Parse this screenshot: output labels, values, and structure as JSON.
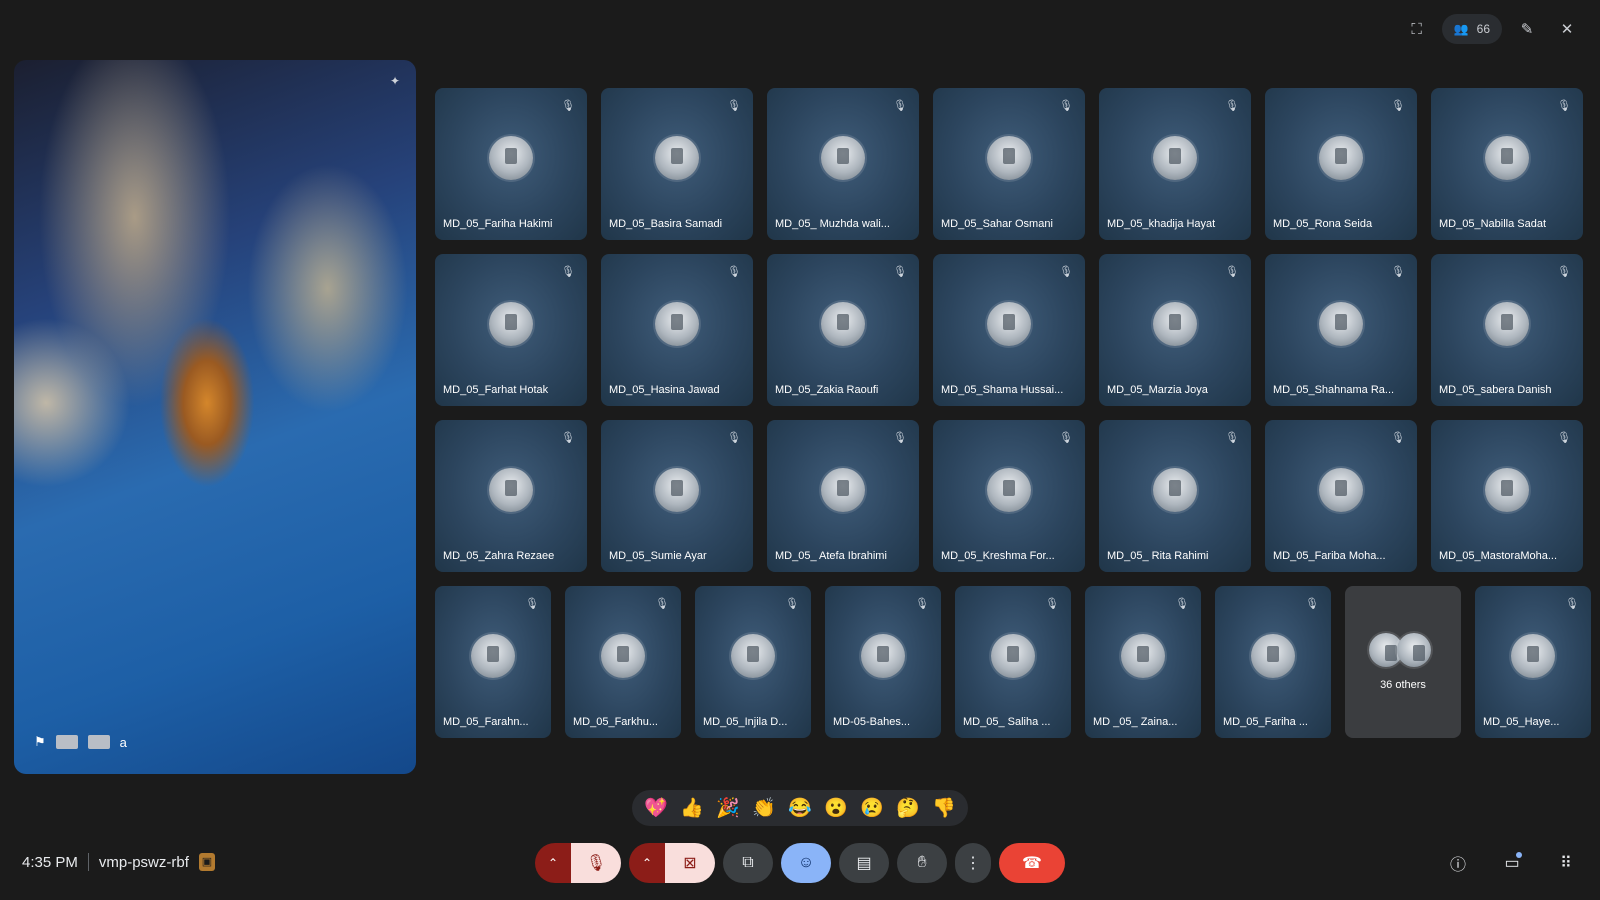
{
  "topbar": {
    "participant_count": "66"
  },
  "presenter": {
    "name_visible": "a"
  },
  "participants_grid": [
    [
      "MD_05_Fariha Hakimi",
      "MD_05_Basira Samadi",
      "MD_05_ Muzhda wali...",
      "MD_05_Sahar Osmani",
      "MD_05_khadija Hayat",
      "MD_05_Rona Seida",
      "MD_05_Nabilla Sadat"
    ],
    [
      "MD_05_Farhat Hotak",
      "MD_05_Hasina Jawad",
      "MD_05_Zakia Raoufi",
      "MD_05_Shama Hussai...",
      "MD_05_Marzia Joya",
      "MD_05_Shahnama Ra...",
      "MD_05_sabera Danish"
    ],
    [
      "MD_05_Zahra Rezaee",
      "MD_05_Sumie Ayar",
      "MD_05_ Atefa Ibrahimi",
      "MD_05_Kreshma For...",
      "MD_05_ Rita Rahimi",
      "MD_05_Fariba Moha...",
      "MD_05_MastoraMoha..."
    ],
    [
      "MD_05_Farahn...",
      "MD_05_Farkhu...",
      "MD_05_Injila D...",
      "MD-05-Bahes...",
      "MD_05_ Saliha ...",
      "MD _05_ Zaina...",
      "MD_05_Fariha ...",
      null,
      "MD_05_Haye..."
    ]
  ],
  "others_tile": {
    "label": "36 others"
  },
  "reactions": [
    "💖",
    "👍",
    "🎉",
    "👏",
    "😂",
    "😮",
    "😢",
    "🤔",
    "👎"
  ],
  "footer": {
    "time": "4:35 PM",
    "meeting_code": "vmp-pswz-rbf"
  }
}
